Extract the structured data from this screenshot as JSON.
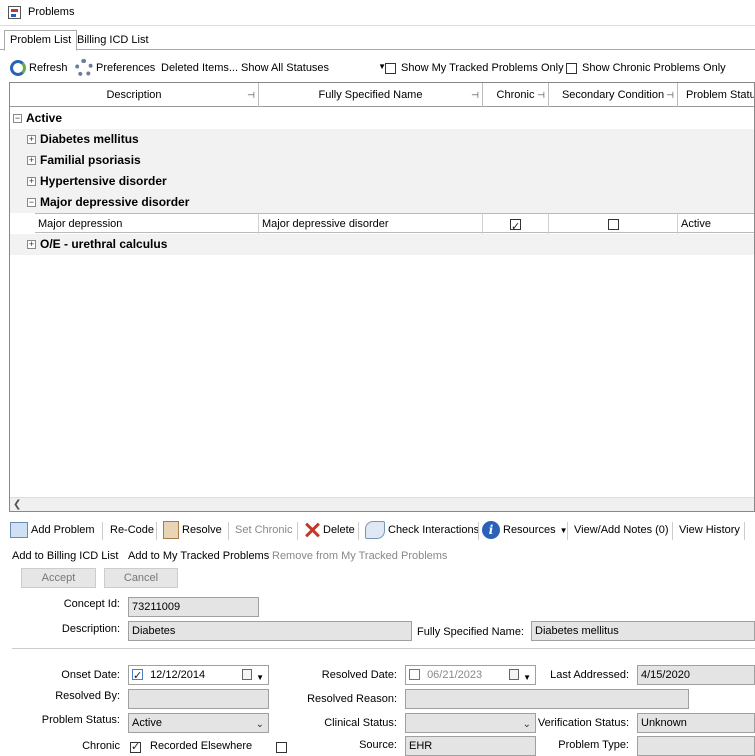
{
  "window": {
    "title": "Problems"
  },
  "tabs": [
    {
      "label": "Problem List",
      "active": true
    },
    {
      "label": "Billing ICD List",
      "active": false
    }
  ],
  "toolbar": {
    "refresh": "Refresh",
    "preferences": "Preferences",
    "deleted_items": "Deleted Items...",
    "status_filter": "Show All Statuses",
    "tracked_only": "Show My Tracked Problems Only",
    "chronic_only": "Show Chronic Problems Only"
  },
  "grid": {
    "columns": [
      "Description",
      "Fully Specified Name",
      "Chronic",
      "Secondary Condition",
      "Problem Status"
    ],
    "group_active": "Active",
    "groups": [
      "Diabetes mellitus",
      "Familial psoriasis",
      "Hypertensive disorder",
      "Major depressive disorder",
      "O/E - urethral calculus"
    ],
    "row": {
      "description": "Major depression",
      "fully_specified_name": "Major depressive disorder",
      "chronic": true,
      "secondary": false,
      "status": "Active"
    }
  },
  "actions": {
    "add_problem": "Add Problem",
    "recode": "Re-Code",
    "resolve": "Resolve",
    "set_chronic": "Set Chronic",
    "delete": "Delete",
    "check_interactions": "Check Interactions",
    "resources": "Resources",
    "view_add_notes": "View/Add Notes (0)",
    "view_history": "View History",
    "add_billing": "Add to Billing ICD List",
    "add_tracked": "Add to My Tracked Problems",
    "remove_tracked": "Remove from My Tracked Problems",
    "accept": "Accept",
    "cancel": "Cancel"
  },
  "details": {
    "concept_id_label": "Concept Id:",
    "concept_id": "73211009",
    "description_label": "Description:",
    "description": "Diabetes",
    "fsn_label": "Fully Specified Name:",
    "fsn": "Diabetes mellitus",
    "onset_label": "Onset Date:",
    "onset": "12/12/2014",
    "resolved_date_label": "Resolved Date:",
    "resolved_date": "06/21/2023",
    "last_addressed_label": "Last Addressed:",
    "last_addressed": "4/15/2020",
    "resolved_by_label": "Resolved By:",
    "resolved_reason_label": "Resolved Reason:",
    "problem_status_label": "Problem Status:",
    "problem_status": "Active",
    "clinical_status_label": "Clinical Status:",
    "verification_label": "Verification Status:",
    "verification": "Unknown",
    "chronic_label": "Chronic",
    "recorded_elsewhere_label": "Recorded Elsewhere",
    "source_label": "Source:",
    "source": "EHR",
    "problem_type_label": "Problem Type:"
  }
}
